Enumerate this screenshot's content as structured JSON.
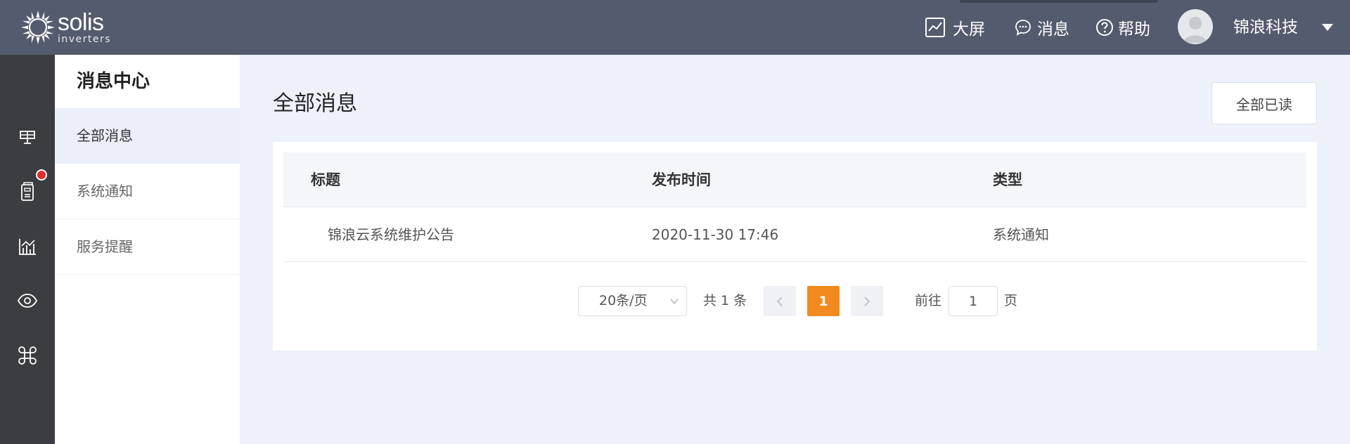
{
  "brand": {
    "name": "solis",
    "sub": "inverters"
  },
  "header": {
    "nav": [
      {
        "label": "大屏",
        "icon": "trend-chart-icon"
      },
      {
        "label": "消息",
        "icon": "chat-bubble-icon"
      },
      {
        "label": "帮助",
        "icon": "help-circle-icon"
      }
    ],
    "user_name": "锦浪科技"
  },
  "rail": {
    "items": [
      "plant-icon",
      "inverter-device-icon",
      "analytics-chart-icon",
      "monitor-eye-icon",
      "apps-command-icon"
    ],
    "badge_on": "inverter-device-icon"
  },
  "subnav": {
    "title": "消息中心",
    "items": [
      {
        "label": "全部消息",
        "active": true
      },
      {
        "label": "系统通知",
        "active": false
      },
      {
        "label": "服务提醒",
        "active": false
      }
    ]
  },
  "main": {
    "title": "全部消息",
    "read_all_label": "全部已读",
    "table": {
      "columns": [
        "标题",
        "发布时间",
        "类型"
      ],
      "rows": [
        {
          "title": "锦浪云系统维护公告",
          "time": "2020-11-30 17:46",
          "type": "系统通知"
        }
      ]
    },
    "pagination": {
      "page_size": "20条/页",
      "total": "共 1 条",
      "current_page": "1",
      "goto_label": "前往",
      "goto_value": "1",
      "goto_unit": "页"
    }
  },
  "colors": {
    "topbar": "#555b6e",
    "rail": "#3c3d40",
    "accent": "#f18a1f",
    "badge": "#e22b2b"
  }
}
